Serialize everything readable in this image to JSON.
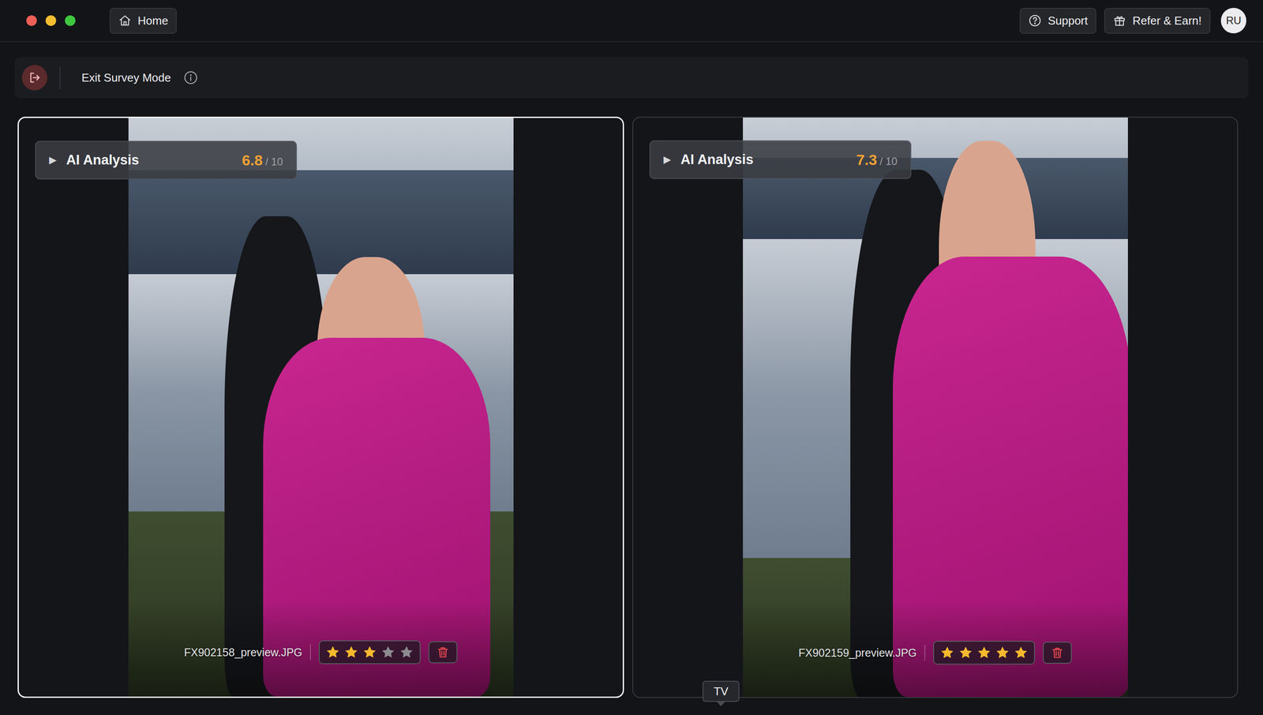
{
  "nav": {
    "home": "Home"
  },
  "header_buttons": [
    {
      "label": "Support"
    },
    {
      "label": "Refer & Earn!"
    }
  ],
  "avatar": "RU",
  "toolbar": {
    "label": "Exit Survey Mode"
  },
  "photos": [
    {
      "selected": true,
      "expanded": false,
      "toggle": "▶",
      "analysis_label": "AI Analysis",
      "score": "6.8",
      "score_max": "/ 10",
      "filename": "FX902158_preview.JPG",
      "stars": 3,
      "stars_total": 5
    },
    {
      "selected": false,
      "expanded": false,
      "toggle": "▶",
      "analysis_label": "AI Analysis",
      "score": "7.3",
      "score_max": "/ 10",
      "filename": "FX902159_preview.JPG",
      "stars": 5,
      "stars_total": 5
    }
  ],
  "tooltip": "TV"
}
